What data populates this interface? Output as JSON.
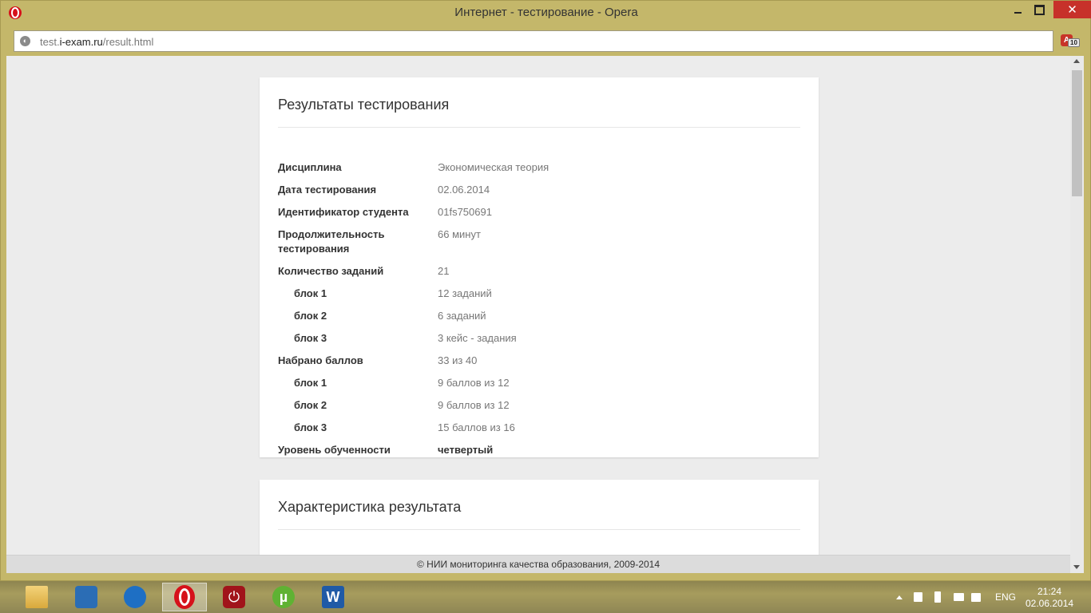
{
  "window": {
    "title": "Интернет - тестирование - Opera",
    "close_symbol": "✕"
  },
  "address_bar": {
    "url_prefix": "test.",
    "url_domain": "i-exam.ru",
    "url_path": "/result.html"
  },
  "results_card": {
    "title": "Результаты тестирования",
    "rows": [
      {
        "label": "Дисциплина",
        "value": "Экономическая теория"
      },
      {
        "label": "Дата тестирования",
        "value": "02.06.2014"
      },
      {
        "label": "Идентификатор студента",
        "value": "01fs750691"
      },
      {
        "label": "Продолжительность тестирования",
        "value": "66 минут"
      },
      {
        "label": "Количество заданий",
        "value": "21"
      },
      {
        "label": "блок 1",
        "value": "12 заданий"
      },
      {
        "label": "блок 2",
        "value": "6 заданий"
      },
      {
        "label": "блок 3",
        "value": "3 кейс - задания"
      },
      {
        "label": "Набрано баллов",
        "value": "33 из 40"
      },
      {
        "label": "блок 1",
        "value": "9 баллов из 12"
      },
      {
        "label": "блок 2",
        "value": "9 баллов из 12"
      },
      {
        "label": "блок 3",
        "value": "15 баллов из 16"
      },
      {
        "label": "Уровень обученности",
        "value": "четвертый"
      }
    ]
  },
  "characteristic_card": {
    "title": "Характеристика результата"
  },
  "footer": {
    "text": "© НИИ мониторинга качества образования, 2009-2014"
  },
  "taskbar": {
    "apps": [
      "file-explorer",
      "control-panel",
      "updater",
      "opera",
      "power-off",
      "utorrent",
      "word"
    ],
    "active_app": "opera",
    "language": "ENG",
    "time": "21:24",
    "date": "02.06.2014"
  }
}
